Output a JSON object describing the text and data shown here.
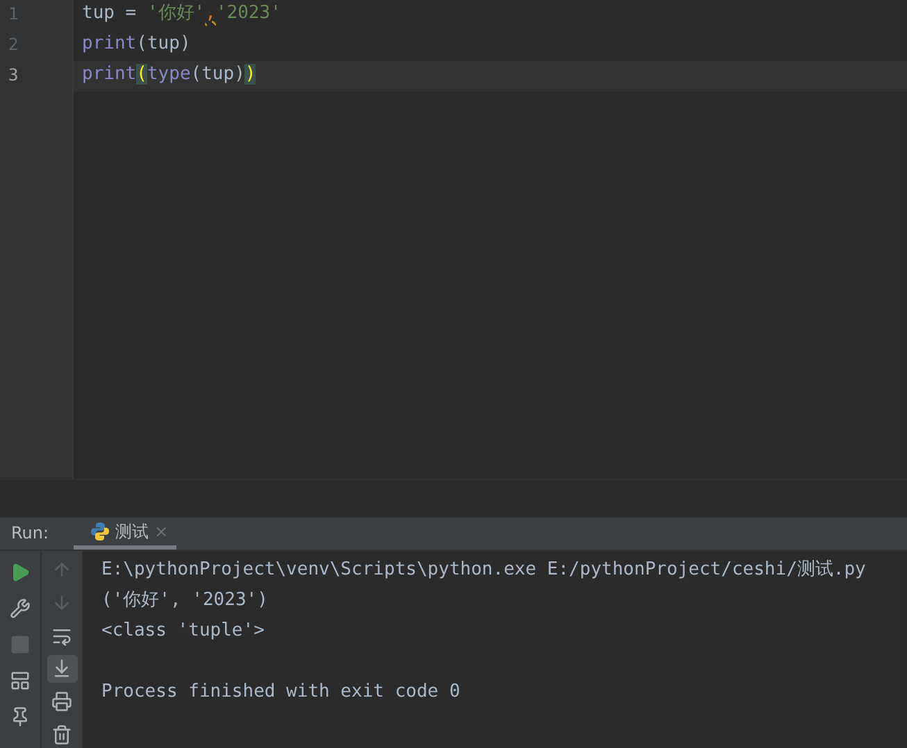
{
  "editor": {
    "lines": [
      {
        "number": "1",
        "current": false,
        "tokens": [
          {
            "kind": "plain",
            "text": "tup = "
          },
          {
            "kind": "string",
            "text": "'你好'"
          },
          {
            "kind": "warning",
            "text": ","
          },
          {
            "kind": "string",
            "text": "'2023'"
          }
        ]
      },
      {
        "number": "2",
        "current": false,
        "tokens": [
          {
            "kind": "builtin",
            "text": "print"
          },
          {
            "kind": "plain",
            "text": "(tup)"
          }
        ]
      },
      {
        "number": "3",
        "current": true,
        "tokens": [
          {
            "kind": "builtin",
            "text": "print"
          },
          {
            "kind": "match",
            "text": "("
          },
          {
            "kind": "builtin",
            "text": "type"
          },
          {
            "kind": "plain",
            "text": "(tup)"
          },
          {
            "kind": "match",
            "text": ")"
          }
        ]
      }
    ]
  },
  "run_panel": {
    "label": "Run:",
    "tabs": [
      {
        "label": "测试",
        "close": "×",
        "selected": true
      }
    ],
    "toolbar_left": [
      {
        "kind": "run",
        "disabled": false
      },
      {
        "kind": "wrench",
        "disabled": false
      },
      {
        "kind": "stop",
        "disabled": true
      },
      {
        "kind": "layout",
        "disabled": false
      },
      {
        "kind": "pin",
        "disabled": false
      }
    ],
    "toolbar_right": [
      {
        "kind": "up",
        "disabled": true,
        "selected": false
      },
      {
        "kind": "down",
        "disabled": true,
        "selected": false
      },
      {
        "kind": "wrap",
        "disabled": false,
        "selected": false
      },
      {
        "kind": "scroll-end",
        "disabled": false,
        "selected": true
      },
      {
        "kind": "print",
        "disabled": false,
        "selected": false
      },
      {
        "kind": "delete",
        "disabled": false,
        "selected": false
      }
    ],
    "console": [
      {
        "kind": "output",
        "text": "E:\\pythonProject\\venv\\Scripts\\python.exe E:/pythonProject/ceshi/测试.py"
      },
      {
        "kind": "output",
        "text": "('你好', '2023')"
      },
      {
        "kind": "output",
        "text": "<class 'tuple'>"
      },
      {
        "kind": "exit",
        "text": "Process finished with exit code 0"
      }
    ]
  }
}
